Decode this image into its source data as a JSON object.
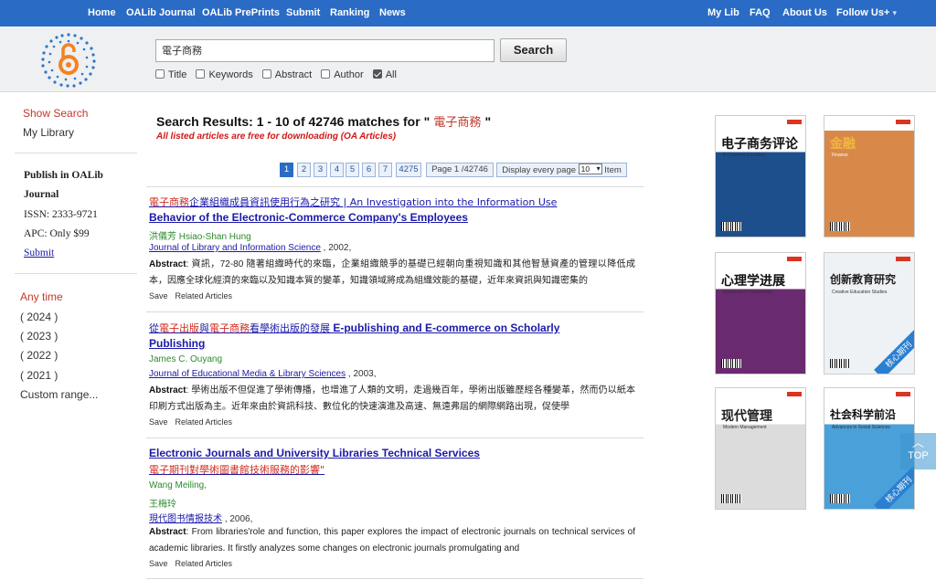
{
  "nav": {
    "left": [
      "Home",
      "OALib Journal",
      "OALib PrePrints",
      "Submit",
      "Ranking",
      "News"
    ],
    "right": [
      "My Lib",
      "FAQ",
      "About Us",
      "Follow Us+"
    ],
    "follow_arrow": "▾"
  },
  "search": {
    "query": "電子商務",
    "button": "Search",
    "filters": [
      {
        "label": "Title",
        "checked": false
      },
      {
        "label": "Keywords",
        "checked": false
      },
      {
        "label": "Abstract",
        "checked": false
      },
      {
        "label": "Author",
        "checked": false
      },
      {
        "label": "All",
        "checked": true
      }
    ]
  },
  "sidebar": {
    "show_search": "Show Search",
    "my_library": "My Library",
    "publish_line1": "Publish in OALib",
    "publish_line2": "Journal",
    "issn": "ISSN: 2333-9721",
    "apc": "APC: Only $99",
    "submit": "Submit",
    "any_time": "Any time",
    "years": [
      "( 2024 )",
      "( 2023 )",
      "( 2022 )",
      "( 2021 )"
    ],
    "custom_range": "Custom range..."
  },
  "results": {
    "heading_prefix": "Search Results: 1 - 10 of 42746 matches for \"",
    "query": " 電子商務 ",
    "heading_suffix": "\"",
    "oa_note": "All listed articles are free for downloading (OA Articles)",
    "pager": {
      "pages": [
        "1",
        "2",
        "3",
        "4",
        "5",
        "6",
        "7",
        "4275"
      ],
      "page_info": "Page 1 /42746",
      "display_prefix": "Display every page",
      "per_page": "10",
      "display_suffix": "Item"
    },
    "items": [
      {
        "title_hl": "電子商務",
        "title_rest": "企業組織成員資訊使用行為之研究 | An Investigation into the Information Use",
        "title_line2": "Behavior of the Electronic-Commerce Company's Employees",
        "author": "洪儀芳 Hsiao-Shan Hung",
        "journal": "Journal of Library and Information Science",
        "year": " , 2002,",
        "abstract_label": "Abstract",
        "abstract": ": 資訊，72-80 隨著組織時代的來臨，企業組織競爭的基礎已經朝向重視知識和其他智慧資產的管理以降低成本，因應全球化經濟的來臨以及知識本質的變革，知識領域將成為組織效能的基礎，近年來資訊與知識密集的",
        "save": "Save",
        "related": "Related Articles"
      },
      {
        "title_pre": "從",
        "title_hl": "電子出版",
        "title_mid": "與",
        "title_hl2": "電子商務",
        "title_post": "看學術出版的發展",
        "title_en": " E-publishing and E-commerce on Scholarly",
        "title_line2": "Publishing",
        "author": "James C. Ouyang",
        "journal": "Journal of Educational Media & Library Sciences",
        "year": " , 2003,",
        "abstract_label": "Abstract",
        "abstract": ": 學術出版不但促進了學術傳播，也增進了人類的文明，走過幾百年，學術出版雖歷經各種變革，然而仍以紙本印刷方式出版為主。近年來由於資訊科技、數位化的快速演進及高速、無遠弗屆的網際網路出現，促使學",
        "save": "Save",
        "related": "Related Articles"
      },
      {
        "title": "Electronic Journals and University Libraries Technical Services",
        "title_line2": "電子期刊對學術圖書館技術服務的影響\"",
        "author": "Wang Meiling,",
        "author2": "王梅玲",
        "journal": "現代图书情报技术",
        "year": " , 2006,",
        "abstract_label": "Abstract",
        "abstract": ": From libraries'role and function, this paper explores the impact of electronic journals on technical services of academic libraries. It firstly analyzes some changes on electronic journals promulgating and",
        "save": "Save",
        "related": "Related Articles"
      }
    ]
  },
  "covers": [
    {
      "title": "电子商务评论",
      "subtitle": "E-Commerce Letters",
      "bg": "#1d4f8c",
      "fg": "#111"
    },
    {
      "title": "金融",
      "subtitle": "Finance",
      "bg": "#c4622a",
      "fg": "#e0a030"
    },
    {
      "title": "心理学进展",
      "subtitle": "Advances in Psychology",
      "bg": "#7a2d7d",
      "fg": "#111"
    },
    {
      "title": "创新教育研究",
      "subtitle": "Creative Education Studies",
      "bg": "#eef2f5",
      "fg": "#222",
      "ribbon": "核心期刊"
    },
    {
      "title": "现代管理",
      "subtitle": "Modern Management",
      "bg": "#e8e8e8",
      "fg": "#222"
    },
    {
      "title": "社会科学前沿",
      "subtitle": "Advances in Social Sciences",
      "bg": "#4aa0d8",
      "fg": "#111",
      "ribbon": "核心期刊"
    }
  ],
  "top_button": {
    "arrow": "︿",
    "label": "TOP"
  },
  "colors": {
    "nav_bg": "#2a6cc5",
    "link": "#1a1aa8",
    "highlight": "#d02b1f",
    "author": "#2c8a2c",
    "side_accent": "#c0392b"
  }
}
